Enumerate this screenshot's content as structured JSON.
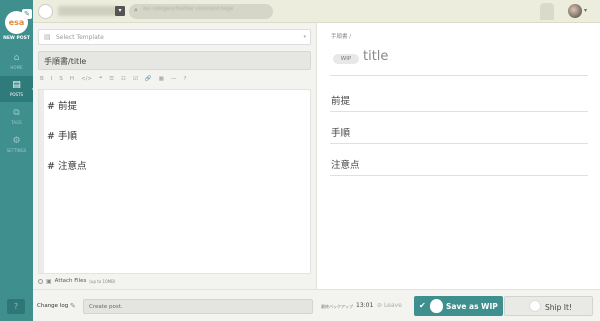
{
  "rail": {
    "logo_text": "esa",
    "new_post": "NEW POST",
    "items": [
      {
        "label": "HOME",
        "icon": "home-icon"
      },
      {
        "label": "POSTS",
        "icon": "document-icon"
      },
      {
        "label": "TAGS",
        "icon": "tag-icon"
      },
      {
        "label": "SETTINGS",
        "icon": "gear-icon"
      }
    ],
    "help": "?"
  },
  "topbar": {
    "team_toggle": "▾",
    "search_placeholder": "ex) category:foo/bar comment:hoge",
    "user_caret": "▾"
  },
  "editor": {
    "template_placeholder": "Select Template",
    "template_caret": "▾",
    "title_value": "手順書/title",
    "toolbar": [
      "B",
      "I",
      "S",
      "H",
      "</>",
      "❝",
      "☰",
      "☷",
      "☑",
      "🔗",
      "▦",
      "—",
      "?"
    ],
    "lines": [
      "# 前提",
      "# 手順",
      "# 注意点"
    ],
    "attach_label": "Attach Files",
    "attach_sub": "(up to 10MB)"
  },
  "preview": {
    "crumb": "手順書 /",
    "wip": "WIP",
    "title": "title",
    "headings": [
      "前提",
      "手順",
      "注意点"
    ]
  },
  "bottom": {
    "changelog_label": "Change log",
    "changelog_value": "Create post.",
    "backup_label": "最終バックアップ",
    "backup_time": "13:01",
    "leave": "Leave",
    "save_wip": "Save as WIP",
    "ship": "Ship It!"
  }
}
